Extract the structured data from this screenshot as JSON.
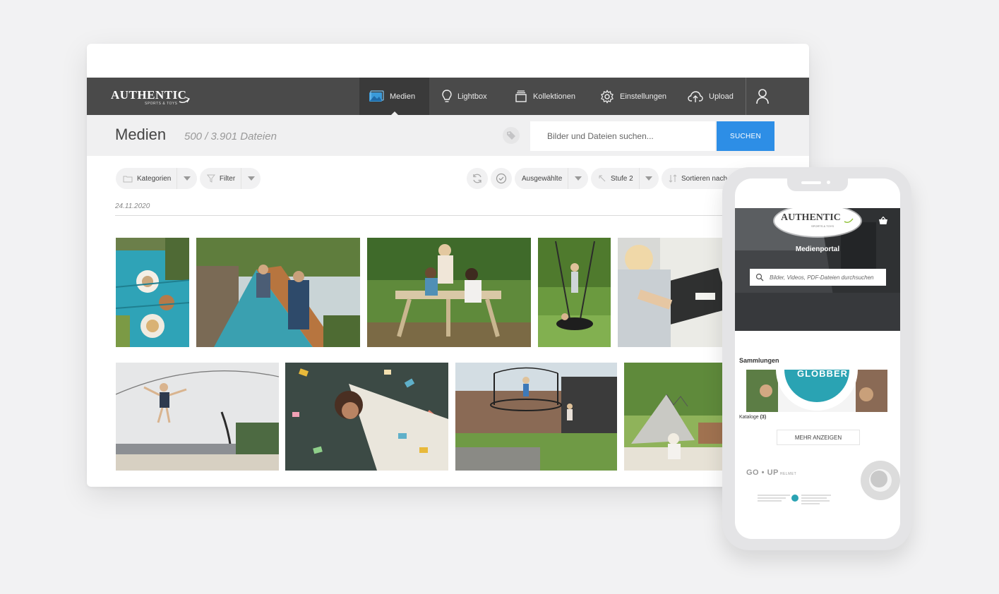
{
  "brand": {
    "word": "AUTHENTIC",
    "sub": "SPORTS & TOYS"
  },
  "nav": {
    "items": [
      {
        "label": "Medien",
        "icon": "image-icon"
      },
      {
        "label": "Lightbox",
        "icon": "lightbulb-icon"
      },
      {
        "label": "Kollektionen",
        "icon": "box-icon"
      },
      {
        "label": "Einstellungen",
        "icon": "gear-icon"
      },
      {
        "label": "Upload",
        "icon": "cloud-upload-icon"
      }
    ],
    "user_icon": "user-icon"
  },
  "header": {
    "title": "Medien",
    "count": "500 / 3.901 Dateien",
    "search_placeholder": "Bilder und Dateien suchen...",
    "search_button": "SUCHEN"
  },
  "toolbar": {
    "kategorien": "Kategorien",
    "filter": "Filter",
    "ausgewaehlte": "Ausgewählte",
    "stufe": "Stufe 2",
    "sortieren": "Sortieren nach"
  },
  "gallery": {
    "date": "24.11.2020"
  },
  "colors": {
    "navbar": "#4a4a4a",
    "accent": "#2d8ee6",
    "subheader": "#f0f0f1"
  },
  "mobile": {
    "brand_word": "AUTHENTIC",
    "brand_sub": "SPORTS & TOYS",
    "hero_title": "Medienportal",
    "search_placeholder": "Bilder, Videos, PDF-Dateien durchsuchen",
    "section_title": "Sammlungen",
    "banner_text": "GLOBBER",
    "collection_name": "Kataloge",
    "collection_count": "(3)",
    "more_button": "MEHR ANZEIGEN",
    "goup_logo": "GO • UP",
    "goup_sub": "HELMET"
  }
}
